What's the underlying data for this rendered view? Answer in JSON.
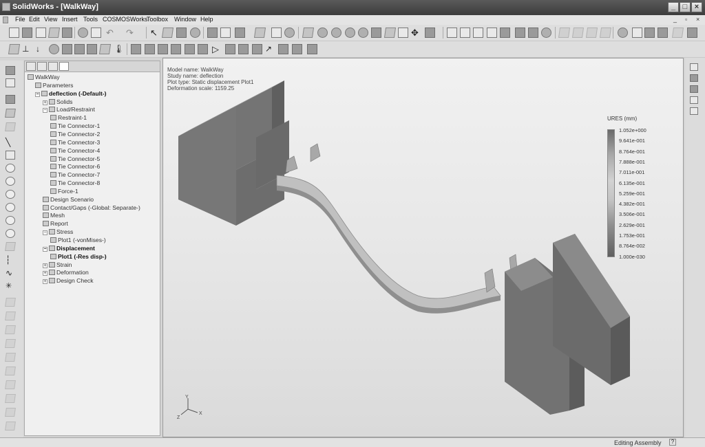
{
  "window": {
    "app_title": "SolidWorks - [WalkWay]",
    "doc_controls": [
      "_",
      "▫",
      "×"
    ]
  },
  "menu": [
    "File",
    "Edit",
    "View",
    "Insert",
    "Tools",
    "COSMOSWorks",
    "Toolbox",
    "Window",
    "Help"
  ],
  "feature_manager": {
    "tree": [
      {
        "label": "WalkWay",
        "indent": 0,
        "bold": false,
        "expander": ""
      },
      {
        "label": "Parameters",
        "indent": 1,
        "bold": false,
        "expander": ""
      },
      {
        "label": "deflection (-Default-)",
        "indent": 1,
        "bold": true,
        "expander": "−"
      },
      {
        "label": "Solids",
        "indent": 2,
        "bold": false,
        "expander": "+"
      },
      {
        "label": "Load/Restraint",
        "indent": 2,
        "bold": false,
        "expander": "−"
      },
      {
        "label": "Restraint-1",
        "indent": 3,
        "bold": false,
        "expander": ""
      },
      {
        "label": "Tie Connector-1",
        "indent": 3,
        "bold": false,
        "expander": ""
      },
      {
        "label": "Tie Connector-2",
        "indent": 3,
        "bold": false,
        "expander": ""
      },
      {
        "label": "Tie Connector-3",
        "indent": 3,
        "bold": false,
        "expander": ""
      },
      {
        "label": "Tie Connector-4",
        "indent": 3,
        "bold": false,
        "expander": ""
      },
      {
        "label": "Tie Connector-5",
        "indent": 3,
        "bold": false,
        "expander": ""
      },
      {
        "label": "Tie Connector-6",
        "indent": 3,
        "bold": false,
        "expander": ""
      },
      {
        "label": "Tie Connector-7",
        "indent": 3,
        "bold": false,
        "expander": ""
      },
      {
        "label": "Tie Connector-8",
        "indent": 3,
        "bold": false,
        "expander": ""
      },
      {
        "label": "Force-1",
        "indent": 3,
        "bold": false,
        "expander": ""
      },
      {
        "label": "Design Scenario",
        "indent": 2,
        "bold": false,
        "expander": ""
      },
      {
        "label": "Contact/Gaps (-Global: Separate-)",
        "indent": 2,
        "bold": false,
        "expander": ""
      },
      {
        "label": "Mesh",
        "indent": 2,
        "bold": false,
        "expander": ""
      },
      {
        "label": "Report",
        "indent": 2,
        "bold": false,
        "expander": ""
      },
      {
        "label": "Stress",
        "indent": 2,
        "bold": false,
        "expander": "−"
      },
      {
        "label": "Plot1 (-vonMises-)",
        "indent": 3,
        "bold": false,
        "expander": ""
      },
      {
        "label": "Displacement",
        "indent": 2,
        "bold": true,
        "expander": "−"
      },
      {
        "label": "Plot1 (-Res disp-)",
        "indent": 3,
        "bold": true,
        "expander": ""
      },
      {
        "label": "Strain",
        "indent": 2,
        "bold": false,
        "expander": "+"
      },
      {
        "label": "Deformation",
        "indent": 2,
        "bold": false,
        "expander": "+"
      },
      {
        "label": "Design Check",
        "indent": 2,
        "bold": false,
        "expander": "+"
      }
    ]
  },
  "viewport": {
    "info": [
      "Model name: WalkWay",
      "Study name: deflection",
      "Plot type: Static displacement Plot1",
      "Deformation scale: 1159.25"
    ],
    "legend_title": "URES (mm)",
    "legend_values": [
      "1.052e+000",
      "9.641e-001",
      "8.764e-001",
      "7.888e-001",
      "7.011e-001",
      "6.135e-001",
      "5.259e-001",
      "4.382e-001",
      "3.506e-001",
      "2.629e-001",
      "1.753e-001",
      "8.764e-002",
      "1.000e-030"
    ],
    "triad": {
      "x": "X",
      "y": "Y",
      "z": "Z"
    }
  },
  "status": {
    "text": "Editing Assembly",
    "help": "?"
  }
}
